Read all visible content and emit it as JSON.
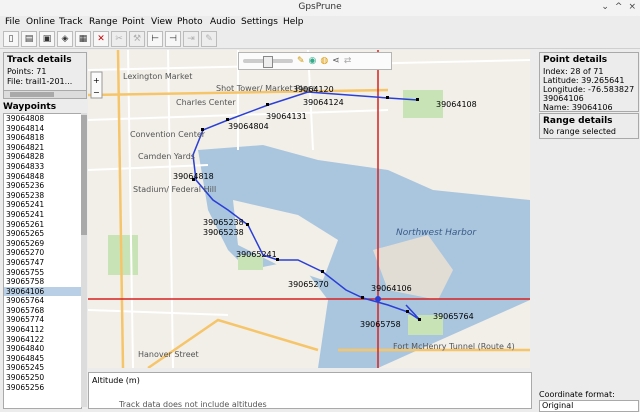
{
  "window": {
    "title": "GpsPrune",
    "controls": [
      "⌄",
      "^",
      "×"
    ]
  },
  "menu": [
    "File",
    "Online",
    "Track",
    "Range",
    "Point",
    "View",
    "Photo",
    "Audio",
    "Settings",
    "Help"
  ],
  "track_details": {
    "header": "Track details",
    "points": "Points: 71",
    "file": "File: trail1-201..."
  },
  "waypoints": {
    "header": "Waypoints",
    "items": [
      "39064808",
      "39064814",
      "39064818",
      "39064821",
      "39064828",
      "39064833",
      "39064848",
      "39065236",
      "39065238",
      "39065241",
      "39065241",
      "39065261",
      "39065265",
      "39065269",
      "39065270",
      "39065747",
      "39065755",
      "39065758",
      "39064106",
      "39065764",
      "39065768",
      "39065774",
      "39064112",
      "39064122",
      "39064840",
      "39064845",
      "39065245",
      "39065250",
      "39065256"
    ],
    "selected_index": 18
  },
  "map": {
    "labels": [
      {
        "text": "Lexington Market",
        "t": "sm"
      },
      {
        "text": "Charles Center",
        "t": "sm"
      },
      {
        "text": "Shot Tower/ Market Place",
        "t": "sm"
      },
      {
        "text": "Convention Center",
        "t": "sm"
      },
      {
        "text": "Camden Yards",
        "t": "sm"
      },
      {
        "text": "Stadium/ Federal Hill",
        "t": "sm"
      },
      {
        "text": "Northwest Harbor",
        "t": "big"
      },
      {
        "text": "Hanover Street",
        "t": "sm"
      },
      {
        "text": "Fort McHenry Tunnel (Route 4)",
        "t": "sm"
      }
    ],
    "waypoint_labels": [
      "39064120",
      "39064124",
      "39064108",
      "39064131",
      "39064804",
      "39064818",
      "39065238",
      "39065238",
      "39065241",
      "39065270",
      "39064106",
      "39065764",
      "39065758"
    ]
  },
  "altitude": {
    "header": "Altitude (m)",
    "message": "Track data does not include altitudes"
  },
  "point_details": {
    "header": "Point details",
    "index": "Index: 28 of 71",
    "latitude": "Latitude: 39.265641",
    "longitude": "Longitude: -76.583827",
    "name1": "39064106",
    "name2": "Name: 39064106"
  },
  "range_details": {
    "header": "Range details",
    "text": "No range selected"
  },
  "coordinate_format": {
    "label": "Coordinate format:",
    "value": "Original"
  },
  "colors": {
    "track": "#2a3fd6",
    "crosshair": "#d82020",
    "water": "#aac6de",
    "land": "#f2efe9"
  }
}
